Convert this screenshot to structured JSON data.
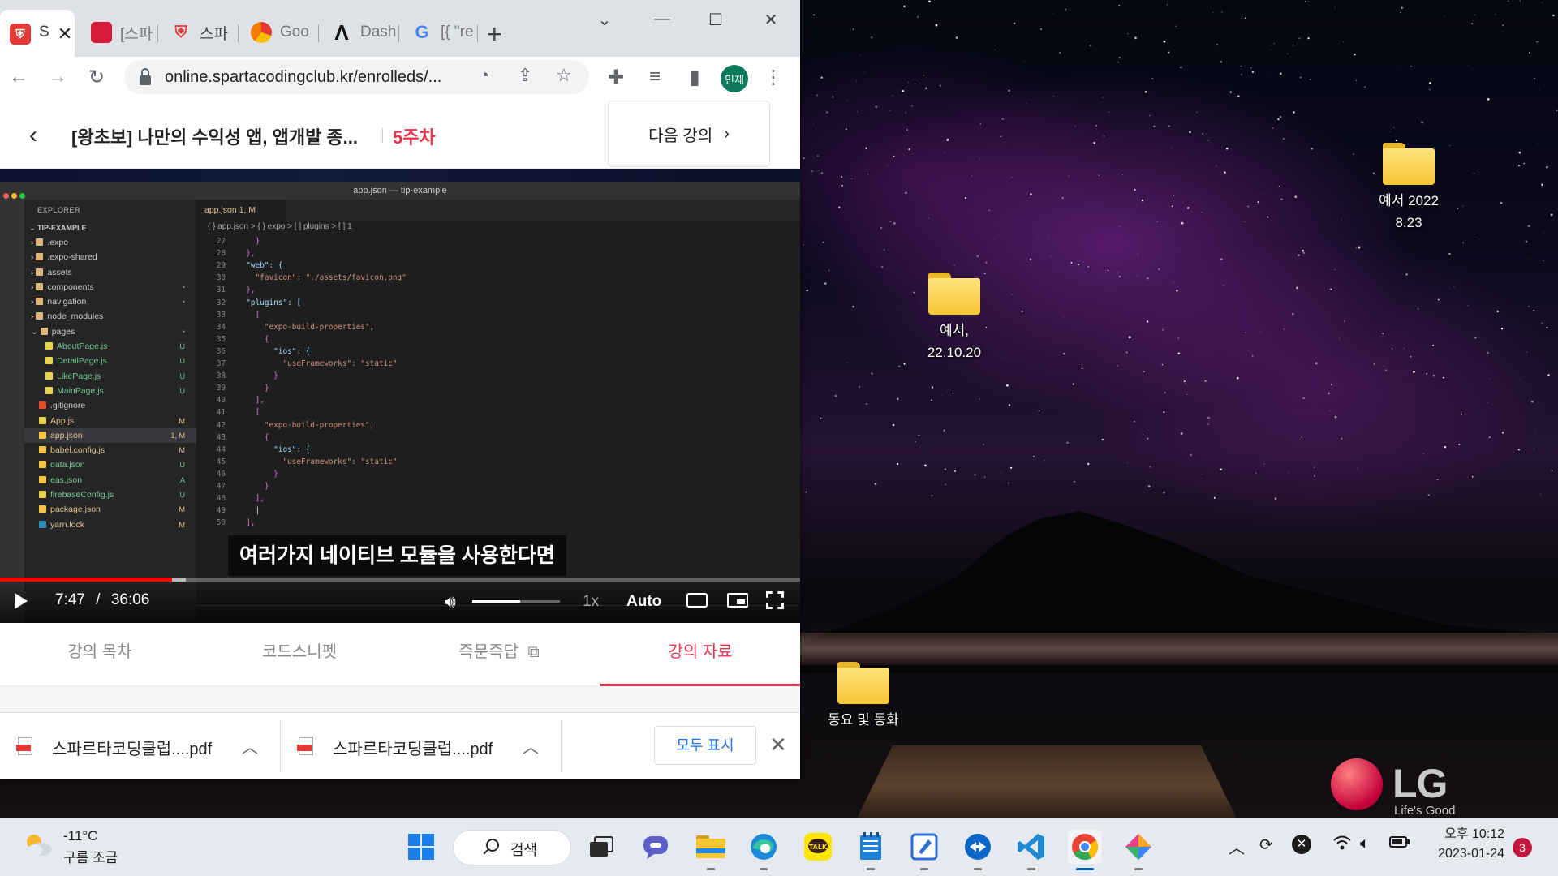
{
  "browser": {
    "tabs": [
      {
        "label": "S"
      },
      {
        "label": "[스파"
      },
      {
        "label": "스파"
      },
      {
        "label": "Goo"
      },
      {
        "label": "Dash"
      },
      {
        "label": "[{ \"re"
      }
    ],
    "new_tab_label": "+",
    "window_controls": {
      "minimize": "—",
      "maximize": "☐",
      "close": "✕",
      "tab_search": "⌄"
    },
    "url": "online.spartacodingclub.kr/enrolleds/...",
    "profile_initials": "민재"
  },
  "lecture": {
    "title": "[왕초보] 나만의 수익성 앱, 앱개발 종...",
    "week": "5주차",
    "next_button": "다음 강의",
    "video": {
      "caption": "여러가지 네이티브 모듈을 사용한다면",
      "current_time": "7:47",
      "time_separator": "/",
      "duration": "36:06",
      "played_fraction": 0.215,
      "buffered_fraction": 0.232,
      "volume_fraction": 0.55,
      "speed": "1x",
      "quality": "Auto",
      "vscode": {
        "window_title": "app.json — tip-example",
        "explorer_label": "EXPLORER",
        "project": "TIP-EXAMPLE",
        "files": [
          {
            "name": ".expo",
            "status": "",
            "kind": "folder"
          },
          {
            "name": ".expo-shared",
            "status": "",
            "kind": "folder"
          },
          {
            "name": "assets",
            "status": "",
            "kind": "folder"
          },
          {
            "name": "components",
            "status": "•",
            "kind": "folder"
          },
          {
            "name": "navigation",
            "status": "•",
            "kind": "folder"
          },
          {
            "name": "node_modules",
            "status": "",
            "kind": "folder"
          },
          {
            "name": "pages",
            "status": "•",
            "kind": "folder-open"
          },
          {
            "name": "AboutPage.js",
            "status": "U",
            "kind": "js"
          },
          {
            "name": "DetailPage.js",
            "status": "U",
            "kind": "js"
          },
          {
            "name": "LikePage.js",
            "status": "U",
            "kind": "js"
          },
          {
            "name": "MainPage.js",
            "status": "U",
            "kind": "js"
          },
          {
            "name": ".gitignore",
            "status": "",
            "kind": "git"
          },
          {
            "name": "App.js",
            "status": "M",
            "kind": "js"
          },
          {
            "name": "app.json",
            "status": "1, M",
            "kind": "json"
          },
          {
            "name": "babel.config.js",
            "status": "M",
            "kind": "json"
          },
          {
            "name": "data.json",
            "status": "U",
            "kind": "json"
          },
          {
            "name": "eas.json",
            "status": "A",
            "kind": "json"
          },
          {
            "name": "firebaseConfig.js",
            "status": "U",
            "kind": "js"
          },
          {
            "name": "package.json",
            "status": "M",
            "kind": "json"
          },
          {
            "name": "yarn.lock",
            "status": "M",
            "kind": "yarn"
          }
        ],
        "editor_tab": "app.json 1, M",
        "breadcrumb": "{ } app.json > { } expo > [ ] plugins > [ ] 1",
        "code_lines": [
          {
            "n": "27",
            "t": "    }"
          },
          {
            "n": "28",
            "t": "  },"
          },
          {
            "n": "29",
            "t": "  \"web\": {"
          },
          {
            "n": "30",
            "t": "    \"favicon\": \"./assets/favicon.png\""
          },
          {
            "n": "31",
            "t": "  },"
          },
          {
            "n": "32",
            "t": "  \"plugins\": ["
          },
          {
            "n": "33",
            "t": "    ["
          },
          {
            "n": "34",
            "t": "      \"expo-build-properties\","
          },
          {
            "n": "35",
            "t": "      {"
          },
          {
            "n": "36",
            "t": "        \"ios\": {"
          },
          {
            "n": "37",
            "t": "          \"useFrameworks\": \"static\""
          },
          {
            "n": "38",
            "t": "        }"
          },
          {
            "n": "39",
            "t": "      }"
          },
          {
            "n": "40",
            "t": "    ],"
          },
          {
            "n": "41",
            "t": "    ["
          },
          {
            "n": "42",
            "t": "      \"expo-build-properties\","
          },
          {
            "n": "43",
            "t": "      {"
          },
          {
            "n": "44",
            "t": "        \"ios\": {"
          },
          {
            "n": "45",
            "t": "          \"useFrameworks\": \"static\""
          },
          {
            "n": "46",
            "t": "        }"
          },
          {
            "n": "47",
            "t": "      }"
          },
          {
            "n": "48",
            "t": "    ],"
          },
          {
            "n": "49",
            "t": "    |"
          },
          {
            "n": "50",
            "t": "  ],"
          }
        ]
      }
    },
    "tabs": [
      {
        "label": "강의 목차"
      },
      {
        "label": "코드스니펫"
      },
      {
        "label": "즉문즉답"
      },
      {
        "label": "강의 자료"
      }
    ]
  },
  "downloads": {
    "items": [
      {
        "name": "스파르타코딩클럽....pdf"
      },
      {
        "name": "스파르타코딩클럽....pdf"
      }
    ],
    "show_all": "모두 표시"
  },
  "desktop": {
    "icons": [
      {
        "label": "예서 2022 8.23"
      },
      {
        "label": "예서, 22.10.20"
      },
      {
        "label": "동요 및 동화"
      }
    ],
    "brand_logo": "LG",
    "brand_slogan": "Life's Good"
  },
  "taskbar": {
    "weather_temp": "-11°C",
    "weather_desc": "구름 조금",
    "search_label": "검색",
    "time": "오후 10:12",
    "date": "2023-01-24",
    "notification_count": "3"
  },
  "colors": {
    "accent_red": "#e8344e",
    "progress_red": "#ff0000",
    "chrome_tabstrip": "#dee1e6",
    "taskbar_bg": "#e6e9f0"
  }
}
